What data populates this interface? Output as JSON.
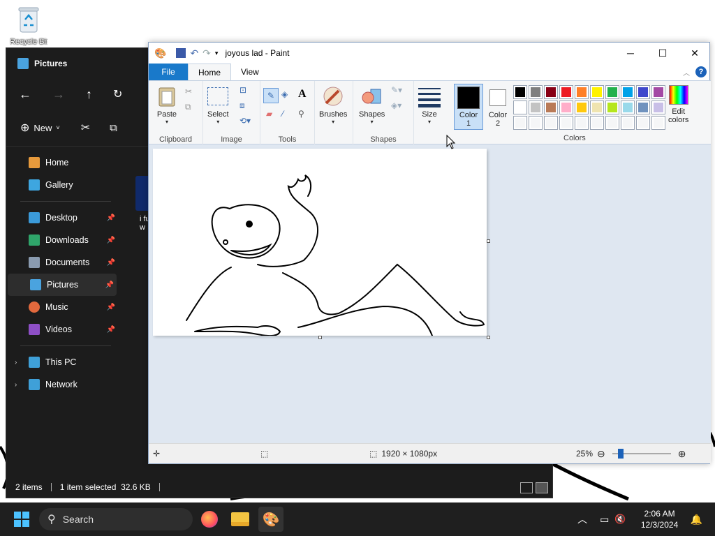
{
  "desktop": {
    "recycle_bin_label": "Recycle Bin"
  },
  "explorer": {
    "title": "Pictures",
    "command_bar": {
      "new_label": "New"
    },
    "nav": [
      {
        "label": "Home",
        "icon": "home-icon",
        "pinned": false
      },
      {
        "label": "Gallery",
        "icon": "gallery-icon",
        "pinned": false
      },
      {
        "label": "Desktop",
        "icon": "desktop-folder-icon",
        "pinned": true
      },
      {
        "label": "Downloads",
        "icon": "downloads-folder-icon",
        "pinned": true
      },
      {
        "label": "Documents",
        "icon": "documents-folder-icon",
        "pinned": true
      },
      {
        "label": "Pictures",
        "icon": "pictures-folder-icon",
        "pinned": true,
        "selected": true
      },
      {
        "label": "Music",
        "icon": "music-folder-icon",
        "pinned": true
      },
      {
        "label": "Videos",
        "icon": "videos-folder-icon",
        "pinned": true
      },
      {
        "label": "This PC",
        "icon": "this-pc-icon",
        "expandable": true
      },
      {
        "label": "Network",
        "icon": "network-icon",
        "expandable": true
      }
    ],
    "file_partial_label": "i fu\nw",
    "status": {
      "items": "2 items",
      "selection": "1 item selected  32.6 KB"
    }
  },
  "paint": {
    "title": "joyous lad - Paint",
    "tabs": {
      "file": "File",
      "home": "Home",
      "view": "View"
    },
    "ribbon": {
      "clipboard": {
        "paste": "Paste",
        "group": "Clipboard"
      },
      "image": {
        "select": "Select",
        "group": "Image"
      },
      "tools": {
        "group": "Tools"
      },
      "brushes": {
        "label": "Brushes"
      },
      "shapes": {
        "label": "Shapes",
        "group": "Shapes"
      },
      "size": {
        "label": "Size"
      },
      "color1": {
        "label": "Color",
        "num": "1"
      },
      "color2": {
        "label": "Color",
        "num": "2"
      },
      "colors_group": "Colors",
      "edit_colors": {
        "line1": "Edit",
        "line2": "colors"
      }
    },
    "palette_colors": [
      "#000000",
      "#7f7f7f",
      "#880015",
      "#ed1c24",
      "#ff7f27",
      "#fff200",
      "#22b14c",
      "#00a2e8",
      "#3f48cc",
      "#a349a4",
      "#ffffff",
      "#c3c3c3",
      "#b97a57",
      "#ffaec9",
      "#ffc90e",
      "#efe4b0",
      "#b5e61d",
      "#99d9ea",
      "#7092be",
      "#c8bfe7"
    ],
    "color1_value": "#000000",
    "color2_value": "#ffffff",
    "status": {
      "dimensions": "1920 × 1080px",
      "zoom": "25%"
    }
  },
  "taskbar": {
    "search_label": "Search",
    "time": "2:06 AM",
    "date": "12/3/2024"
  }
}
